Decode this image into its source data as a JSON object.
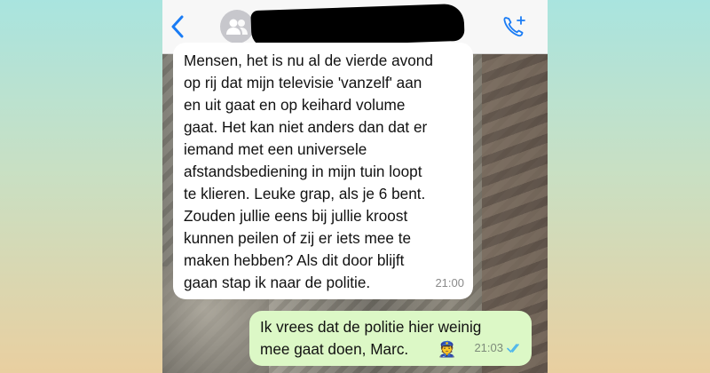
{
  "incoming_message": {
    "text": "Mensen, het is nu al de vierde avond\nop rij dat mijn televisie 'vanzelf' aan\nen uit gaat en op keihard volume\ngaat. Het kan niet anders dan dat er\niemand met een universele\nafstandsbediening in mijn tuin loopt\nte klieren. Leuke grap, als je 6 bent.\nZouden jullie eens bij jullie kroost\nkunnen peilen of zij er iets mee te\nmaken hebben? Als dit door blijft\ngaan stap ik naar de politie.",
    "time": "21:00"
  },
  "outgoing_message": {
    "text": "Ik vrees dat de politie hier weinig\nmee gaat doen, Marc.",
    "emoji": "👮",
    "time": "21:03",
    "status_icon": "double-check-icon"
  },
  "colors": {
    "accent": "#1a7cf5",
    "outgoing_bubble": "#dcf8c6",
    "read_ticks": "#4fb6ec"
  },
  "icons": {
    "back": "chevron-left-icon",
    "avatar": "group-avatar-icon",
    "call": "add-call-icon"
  }
}
